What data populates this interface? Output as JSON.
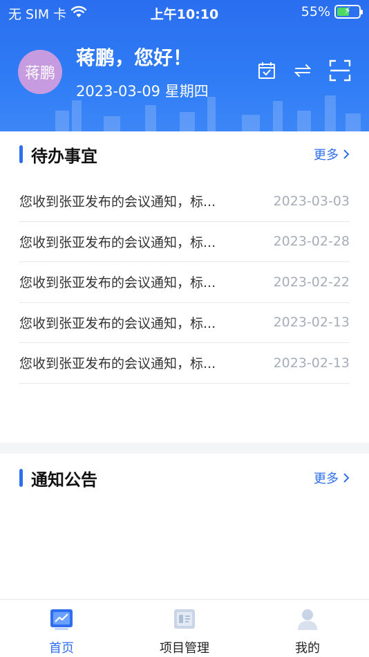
{
  "status_bar": {
    "carrier": "无 SIM 卡",
    "time": "上午10:10",
    "battery_percent": "55%",
    "battery_level": 0.55
  },
  "header": {
    "avatar_text": "蒋鹏",
    "greeting": "蒋鹏，您好！",
    "date": "2023-03-09 星期四",
    "icons": [
      "calendar-icon",
      "switch-icon",
      "scan-icon"
    ]
  },
  "todo": {
    "title": "待办事宜",
    "more_label": "更多",
    "items": [
      {
        "text": "您收到张亚发布的会议通知，标...",
        "date": "2023-03-03"
      },
      {
        "text": "您收到张亚发布的会议通知，标...",
        "date": "2023-02-28"
      },
      {
        "text": "您收到张亚发布的会议通知，标...",
        "date": "2023-02-22"
      },
      {
        "text": "您收到张亚发布的会议通知，标...",
        "date": "2023-02-13"
      },
      {
        "text": "您收到张亚发布的会议通知，标...",
        "date": "2023-02-13"
      }
    ]
  },
  "notice": {
    "title": "通知公告",
    "more_label": "更多"
  },
  "tabbar": {
    "tabs": [
      {
        "label": "首页",
        "icon": "home-icon",
        "active": true
      },
      {
        "label": "项目管理",
        "icon": "project-icon",
        "active": false
      },
      {
        "label": "我的",
        "icon": "profile-icon",
        "active": false
      }
    ]
  },
  "colors": {
    "primary": "#2f6ef0",
    "avatar_bg": "#c79be0",
    "date_gray": "#a6adb9"
  }
}
